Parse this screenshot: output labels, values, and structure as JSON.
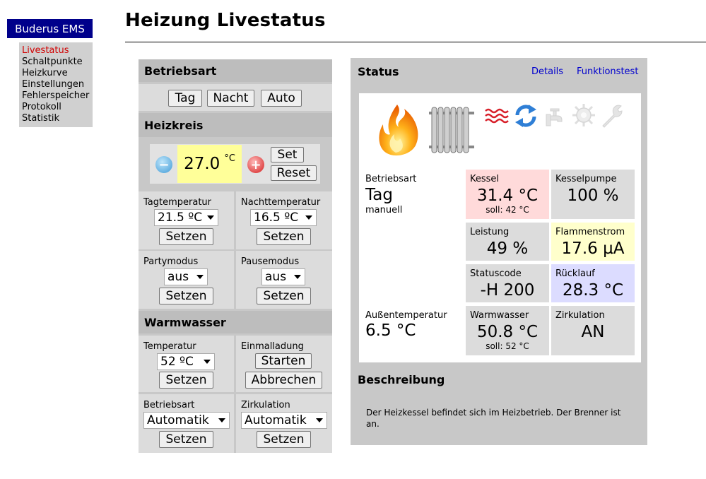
{
  "brand": "Buderus EMS",
  "nav": [
    "Livestatus",
    "Schaltpunkte",
    "Heizkurve",
    "Einstellungen",
    "Fehlerspeicher",
    "Protokoll",
    "Statistik"
  ],
  "page_title": "Heizung Livestatus",
  "left": {
    "betriebsart": {
      "title": "Betriebsart",
      "buttons": [
        "Tag",
        "Nacht",
        "Auto"
      ]
    },
    "heizkreis": {
      "title": "Heizkreis",
      "temp_value": "27.0",
      "temp_unit": "°C",
      "set_label": "Set",
      "reset_label": "Reset",
      "tagtemp_label": "Tagtemperatur",
      "tagtemp_value": "21.5 ºC",
      "nachttemp_label": "Nachttemperatur",
      "nachttemp_value": "16.5 ºC",
      "party_label": "Partymodus",
      "party_value": "aus",
      "pause_label": "Pausemodus",
      "pause_value": "aus",
      "setzen": "Setzen"
    },
    "warmwasser": {
      "title": "Warmwasser",
      "temp_label": "Temperatur",
      "temp_value": "52 ºC",
      "einmal_label": "Einmalladung",
      "starten": "Starten",
      "abbrechen": "Abbrechen",
      "betriebsart_label": "Betriebsart",
      "betriebsart_value": "Automatik",
      "zirk_label": "Zirkulation",
      "zirk_value": "Automatik",
      "setzen": "Setzen"
    }
  },
  "status": {
    "title": "Status",
    "links": [
      "Details",
      "Funktionstest"
    ],
    "betriebsart_label": "Betriebsart",
    "betriebsart_value": "Tag",
    "betriebsart_sub": "manuell",
    "aussen_label": "Außentemperatur",
    "aussen_value": "6.5 °C",
    "boxes": {
      "kessel": {
        "label": "Kessel",
        "value": "31.4 °C",
        "soll": "soll: 42 °C",
        "color": "#ffdada"
      },
      "kesselpumpe": {
        "label": "Kesselpumpe",
        "value": "100 %",
        "color": "#dcdcdc"
      },
      "leistung": {
        "label": "Leistung",
        "value": "49 %",
        "color": "#dcdcdc"
      },
      "flammenstrom": {
        "label": "Flammenstrom",
        "value": "17.6 µA",
        "color": "#ffffcc"
      },
      "statuscode": {
        "label": "Statuscode",
        "value": "-H 200",
        "color": "#dcdcdc"
      },
      "ruecklauf": {
        "label": "Rücklauf",
        "value": "28.3 °C",
        "color": "#dcdcff"
      },
      "warmwasser": {
        "label": "Warmwasser",
        "value": "50.8 °C",
        "soll": "soll: 52 °C",
        "color": "#dcdcdc"
      },
      "zirkulation": {
        "label": "Zirkulation",
        "value": "AN",
        "color": "#dcdcdc"
      }
    },
    "icons": [
      "flame-icon",
      "radiator-icon",
      "heat-waves-icon",
      "circulation-arrows-icon",
      "tap-icon",
      "sun-gear-icon",
      "wrench-icon"
    ],
    "beschreibung_title": "Beschreibung",
    "beschreibung_text": "Der Heizkessel befindet sich im Heizbetrieb. Der Brenner ist an."
  }
}
